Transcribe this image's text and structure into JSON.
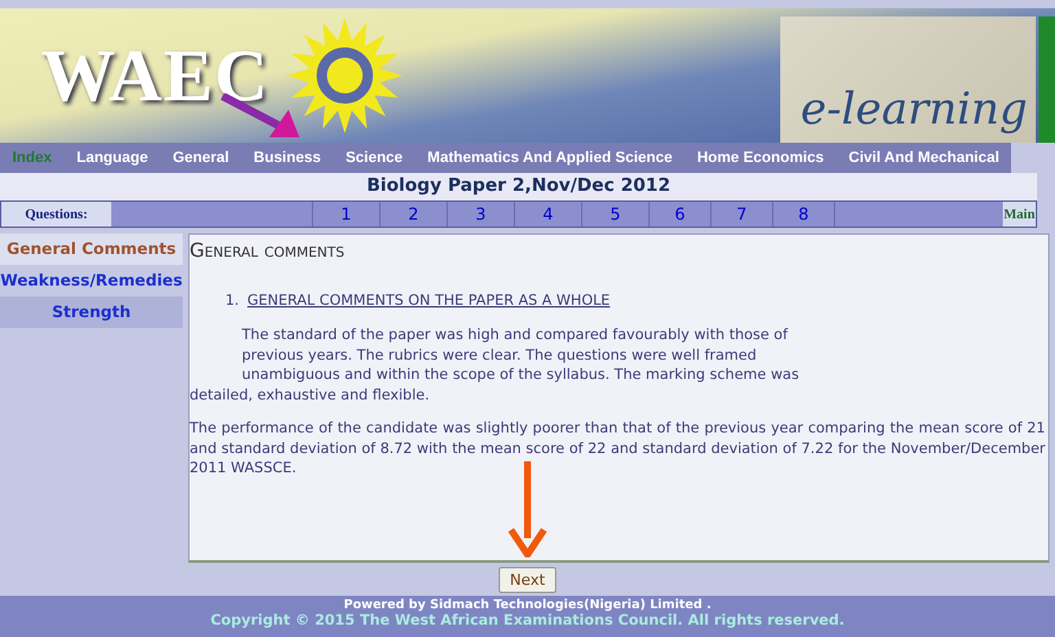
{
  "banner": {
    "logo_text": "WAEC",
    "elearning_text": "e-learning"
  },
  "nav": [
    {
      "label": "Index",
      "selected": true
    },
    {
      "label": "Language",
      "selected": false
    },
    {
      "label": "General",
      "selected": false
    },
    {
      "label": "Business",
      "selected": false
    },
    {
      "label": "Science",
      "selected": false
    },
    {
      "label": "Mathematics And Applied Science",
      "selected": false
    },
    {
      "label": "Home Economics",
      "selected": false
    },
    {
      "label": "Civil And Mechanical",
      "selected": false
    }
  ],
  "page_title": "Biology Paper 2,Nov/Dec 2012",
  "questions": {
    "label": "Questions:",
    "numbers": [
      "1",
      "2",
      "3",
      "4",
      "5",
      "6",
      "7",
      "8"
    ],
    "main": "Main"
  },
  "sidebar": [
    {
      "label": "General Comments",
      "selected": true
    },
    {
      "label": "Weakness/Remedies",
      "selected": false
    },
    {
      "label": "Strength",
      "selected": false
    }
  ],
  "content": {
    "heading": "General comments",
    "item_number": "1.",
    "item_title": "GENERAL COMMENTS ON THE PAPER AS A WHOLE",
    "paragraph_1_lines": [
      "The standard of the paper was high and compared favourably with those of",
      "previous years.  The rubrics were clear.  The questions were well framed",
      "unambiguous and within the scope of the syllabus.  The marking scheme was"
    ],
    "paragraph_1_end": "detailed, exhaustive and flexible.",
    "paragraph_2": "The performance of the candidate was slightly poorer than that of the previous year comparing the mean score of 21 and standard deviation of 8.72  with the mean score of 22 and standard deviation of 7.22 for the November/December 2011 WASSCE."
  },
  "next_button": "Next",
  "footer": {
    "powered_by": "Powered by Sidmach Technologies(Nigeria) Limited .",
    "copyright": "Copyright © 2015 The West African Examinations Council. All rights reserved."
  }
}
